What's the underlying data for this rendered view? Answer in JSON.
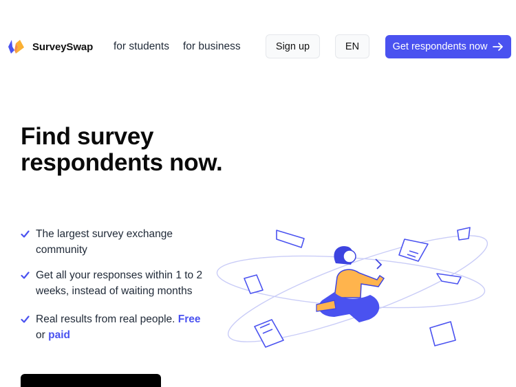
{
  "header": {
    "brand": "SurveySwap",
    "nav": {
      "students": "for students",
      "business": "for business"
    },
    "signup_label": "Sign up",
    "language": "EN",
    "cta_label": "Get respondents now"
  },
  "hero": {
    "title": "Find survey respondents now.",
    "features": [
      {
        "text": "The largest survey exchange community"
      },
      {
        "text": "Get all your responses within 1 to 2 weeks, instead of waiting months"
      },
      {
        "pre": "Real results from real people.",
        "free": "Free",
        "or": "or",
        "paid": "paid"
      }
    ]
  },
  "colors": {
    "accent": "#4a52f0",
    "logo_orange": "#fbb033",
    "illustration_orange": "#ffb44d"
  },
  "icons": {
    "check": "check-icon",
    "arrow": "arrow-right-icon"
  }
}
